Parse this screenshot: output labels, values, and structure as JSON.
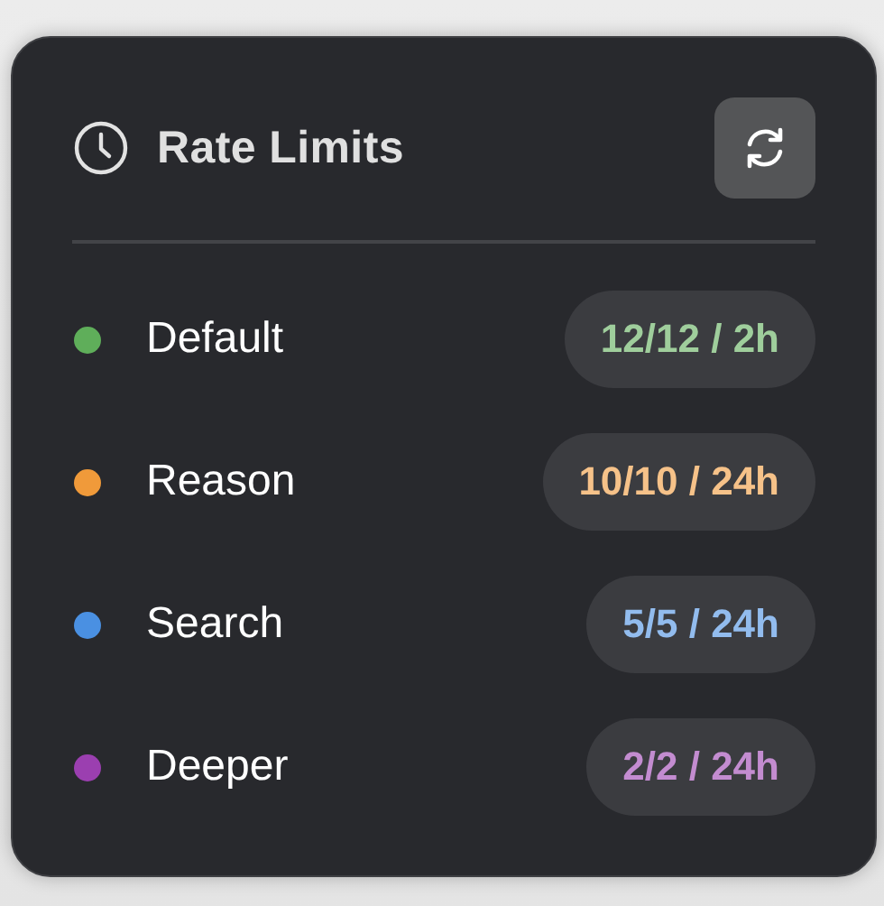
{
  "panel": {
    "title": "Rate Limits"
  },
  "limits": [
    {
      "name": "Default",
      "usage": "12/12 / 2h",
      "color": "#5fae5a"
    },
    {
      "name": "Reason",
      "usage": "10/10 / 24h",
      "color": "#f09a3a"
    },
    {
      "name": "Search",
      "usage": "5/5 / 24h",
      "color": "#4a90e2"
    },
    {
      "name": "Deeper",
      "usage": "2/2 / 24h",
      "color": "#9b3fb0"
    }
  ]
}
